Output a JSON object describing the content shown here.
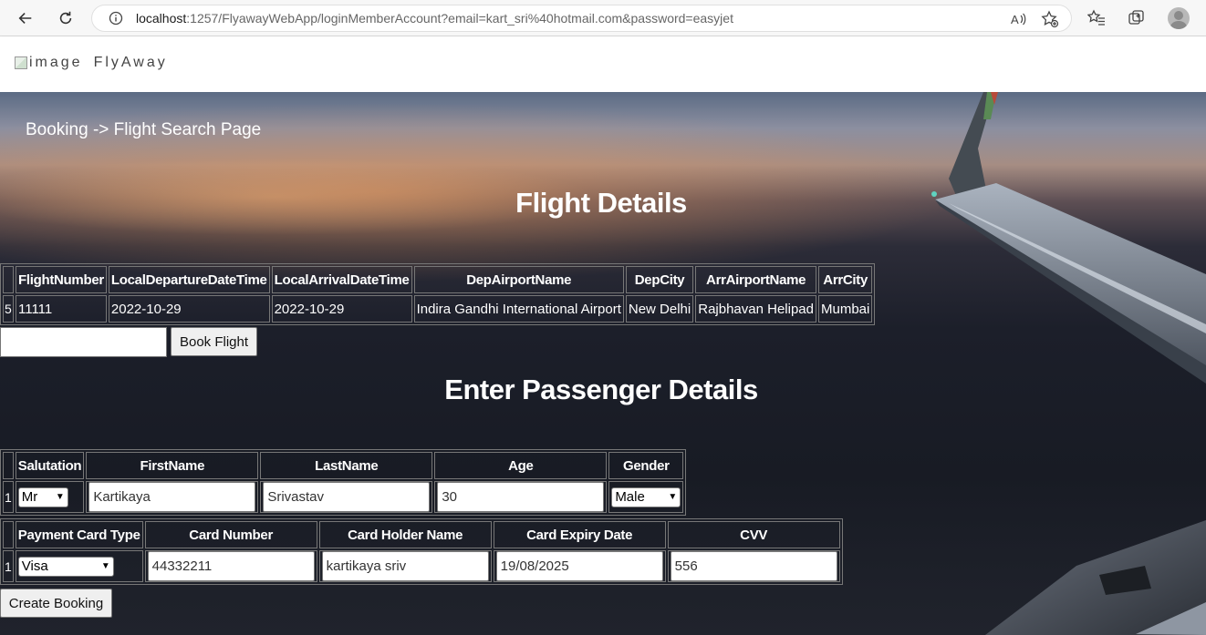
{
  "browser": {
    "url_host": "localhost",
    "url_rest": ":1257/FlyawayWebApp/loginMemberAccount?email=kart_sri%40hotmail.com&password=easyjet"
  },
  "header": {
    "logo_alt": "image",
    "brand": "FlyAway"
  },
  "breadcrumb": "Booking -> Flight Search Page",
  "flight_section": {
    "title": "Flight Details",
    "columns": [
      "FlightNumber",
      "LocalDepartureDateTime",
      "LocalArrivalDateTime",
      "DepAirportName",
      "DepCity",
      "ArrAirportName",
      "ArrCity"
    ],
    "row": {
      "index": "5",
      "flight_number": "11111",
      "departure": "2022-10-29",
      "arrival": "2022-10-29",
      "dep_airport": "Indira Gandhi International Airport",
      "dep_city": "New Delhi",
      "arr_airport": "Rajbhavan Helipad",
      "arr_city": "Mumbai"
    },
    "book_button": "Book Flight",
    "book_input_value": ""
  },
  "passenger_section": {
    "title": "Enter Passenger Details",
    "columns": [
      "Salutation",
      "FirstName",
      "LastName",
      "Age",
      "Gender"
    ],
    "row": {
      "index": "1",
      "salutation": "Mr",
      "first_name": "Kartikaya",
      "last_name": "Srivastav",
      "age": "30",
      "gender": "Male"
    }
  },
  "payment_section": {
    "columns": [
      "Payment Card Type",
      "Card Number",
      "Card Holder Name",
      "Card Expiry Date",
      "CVV"
    ],
    "row": {
      "index": "1",
      "card_type": "Visa",
      "card_number": "44332211",
      "holder_name": "kartikaya sriv",
      "expiry": "19/08/2025",
      "cvv": "556"
    }
  },
  "create_button": "Create Booking",
  "colors": {
    "text_on_hero": "#ffffff",
    "button_bg": "#efefef"
  }
}
